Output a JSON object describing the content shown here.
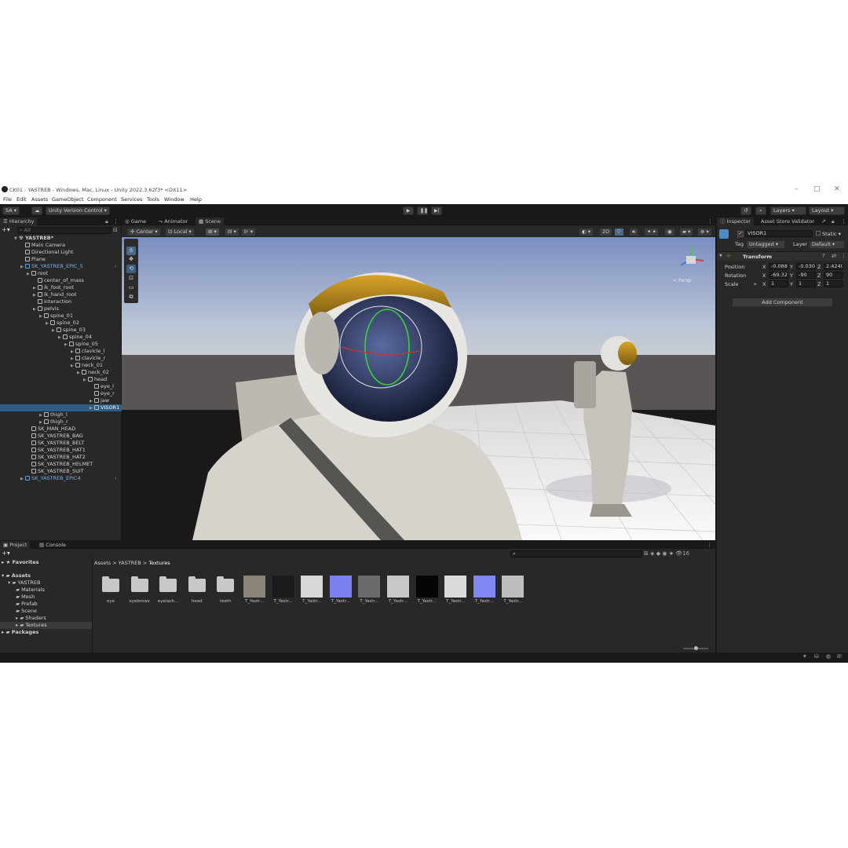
{
  "window": {
    "title": "CK01 - YASTREB - Windows, Mac, Linux - Unity 2022.3.62f3* <DX11>",
    "controls": {
      "minimize": "–",
      "maximize": "□",
      "close": "✕"
    }
  },
  "menu": [
    "File",
    "Edit",
    "Assets",
    "GameObject",
    "Component",
    "Services",
    "Tools",
    "Window",
    "Help"
  ],
  "toolbar": {
    "account": "SA ▾",
    "version_control": "Unity Version Control ▾",
    "layers": "Layers",
    "layout": "Layout"
  },
  "hierarchy": {
    "tab": "Hierarchy",
    "search_placeholder": "All",
    "scene": "YASTREB*",
    "items": [
      {
        "label": "Main Camera",
        "depth": 1,
        "arrow": false
      },
      {
        "label": "Directional Light",
        "depth": 1,
        "arrow": false
      },
      {
        "label": "Plane",
        "depth": 1,
        "arrow": false
      },
      {
        "label": "SK_YASTREB_EPIC_5",
        "depth": 1,
        "arrow": true,
        "blue": true
      },
      {
        "label": "root",
        "depth": 2,
        "arrow": true
      },
      {
        "label": "center_of_mass",
        "depth": 3,
        "arrow": false
      },
      {
        "label": "ik_foot_root",
        "depth": 3,
        "arrow": true
      },
      {
        "label": "ik_hand_root",
        "depth": 3,
        "arrow": true
      },
      {
        "label": "interaction",
        "depth": 3,
        "arrow": false
      },
      {
        "label": "pelvis",
        "depth": 3,
        "arrow": true
      },
      {
        "label": "spine_01",
        "depth": 4,
        "arrow": true
      },
      {
        "label": "spine_02",
        "depth": 5,
        "arrow": true
      },
      {
        "label": "spine_03",
        "depth": 6,
        "arrow": true
      },
      {
        "label": "spine_04",
        "depth": 7,
        "arrow": true
      },
      {
        "label": "spine_05",
        "depth": 8,
        "arrow": true
      },
      {
        "label": "clavicle_l",
        "depth": 9,
        "arrow": true
      },
      {
        "label": "clavicle_r",
        "depth": 9,
        "arrow": true
      },
      {
        "label": "neck_01",
        "depth": 9,
        "arrow": true
      },
      {
        "label": "neck_02",
        "depth": 10,
        "arrow": true
      },
      {
        "label": "head",
        "depth": 11,
        "arrow": true
      },
      {
        "label": "eye_l",
        "depth": 12,
        "arrow": false
      },
      {
        "label": "eye_r",
        "depth": 12,
        "arrow": false
      },
      {
        "label": "jaw",
        "depth": 12,
        "arrow": true
      },
      {
        "label": "VISOR1",
        "depth": 12,
        "arrow": true,
        "selected": true
      },
      {
        "label": "thigh_l",
        "depth": 4,
        "arrow": true
      },
      {
        "label": "thigh_r",
        "depth": 4,
        "arrow": true
      },
      {
        "label": "SK_MAN_HEAD",
        "depth": 2,
        "arrow": false
      },
      {
        "label": "SK_YASTREB_BAG",
        "depth": 2,
        "arrow": false
      },
      {
        "label": "SK_YASTREB_BELT",
        "depth": 2,
        "arrow": false
      },
      {
        "label": "SK_YASTREB_HAT1",
        "depth": 2,
        "arrow": false
      },
      {
        "label": "SK_YASTREB_HAT2",
        "depth": 2,
        "arrow": false
      },
      {
        "label": "SK_YASTREB_HELMET",
        "depth": 2,
        "arrow": false
      },
      {
        "label": "SK_YASTREB_SUIT",
        "depth": 2,
        "arrow": false
      },
      {
        "label": "SK_YASTREB_EPIC4",
        "depth": 1,
        "arrow": true,
        "blue": true
      }
    ]
  },
  "center_tabs": [
    "Game",
    "Animator",
    "Scene"
  ],
  "scene_toolbar": {
    "pivot": "Center",
    "space": "Local",
    "mode_2d": "2D"
  },
  "gizmo": {
    "persp": "< Persp"
  },
  "inspector": {
    "tabs": [
      "Inspector",
      "Asset Store Validator"
    ],
    "object_name": "VISOR1",
    "static": "Static",
    "tag_label": "Tag",
    "tag_value": "Untagged",
    "layer_label": "Layer",
    "layer_value": "Default",
    "component": "Transform",
    "rows": [
      {
        "label": "Position",
        "x": "-0.088",
        "y": "-0.030",
        "z": "2.4240"
      },
      {
        "label": "Rotation",
        "x": "-69.32",
        "y": "-90",
        "z": "90"
      },
      {
        "label": "Scale",
        "x": "1",
        "y": "1",
        "z": "1"
      }
    ],
    "add_component": "Add Component"
  },
  "bottom_tabs": [
    "Project",
    "Console"
  ],
  "project": {
    "favorites": "Favorites",
    "assets": "Assets",
    "tree": [
      "YASTREB",
      "Materials",
      "Mesh",
      "Prefab",
      "Scene",
      "Shaders",
      "Textures"
    ],
    "packages": "Packages",
    "breadcrumb": [
      "Assets",
      "YASTREB",
      "Textures"
    ],
    "count": "16",
    "items": [
      {
        "label": "eye",
        "kind": "folder"
      },
      {
        "label": "eyebrows",
        "kind": "folder"
      },
      {
        "label": "eyelash...",
        "kind": "folder"
      },
      {
        "label": "head",
        "kind": "folder"
      },
      {
        "label": "teeth",
        "kind": "folder"
      },
      {
        "label": "T_Yastr...",
        "kind": "tex",
        "color": "#8a8478"
      },
      {
        "label": "T_Yastr...",
        "kind": "tex",
        "color": "#1a1a1a"
      },
      {
        "label": "T_Yastr...",
        "kind": "tex",
        "color": "#d8d8d8"
      },
      {
        "label": "T_Yastr...",
        "kind": "tex",
        "color": "#7c80f0"
      },
      {
        "label": "T_Yastr...",
        "kind": "tex",
        "color": "#6a6a6a"
      },
      {
        "label": "T_Yastr...",
        "kind": "tex",
        "color": "#c8c8c8"
      },
      {
        "label": "T_Yastr...",
        "kind": "tex",
        "color": "#050505"
      },
      {
        "label": "T_Yastr...",
        "kind": "tex",
        "color": "#dadada"
      },
      {
        "label": "T_Yastr...",
        "kind": "tex",
        "color": "#8187f2"
      },
      {
        "label": "T_Yastr...",
        "kind": "tex",
        "color": "#bdbdbd"
      }
    ]
  }
}
